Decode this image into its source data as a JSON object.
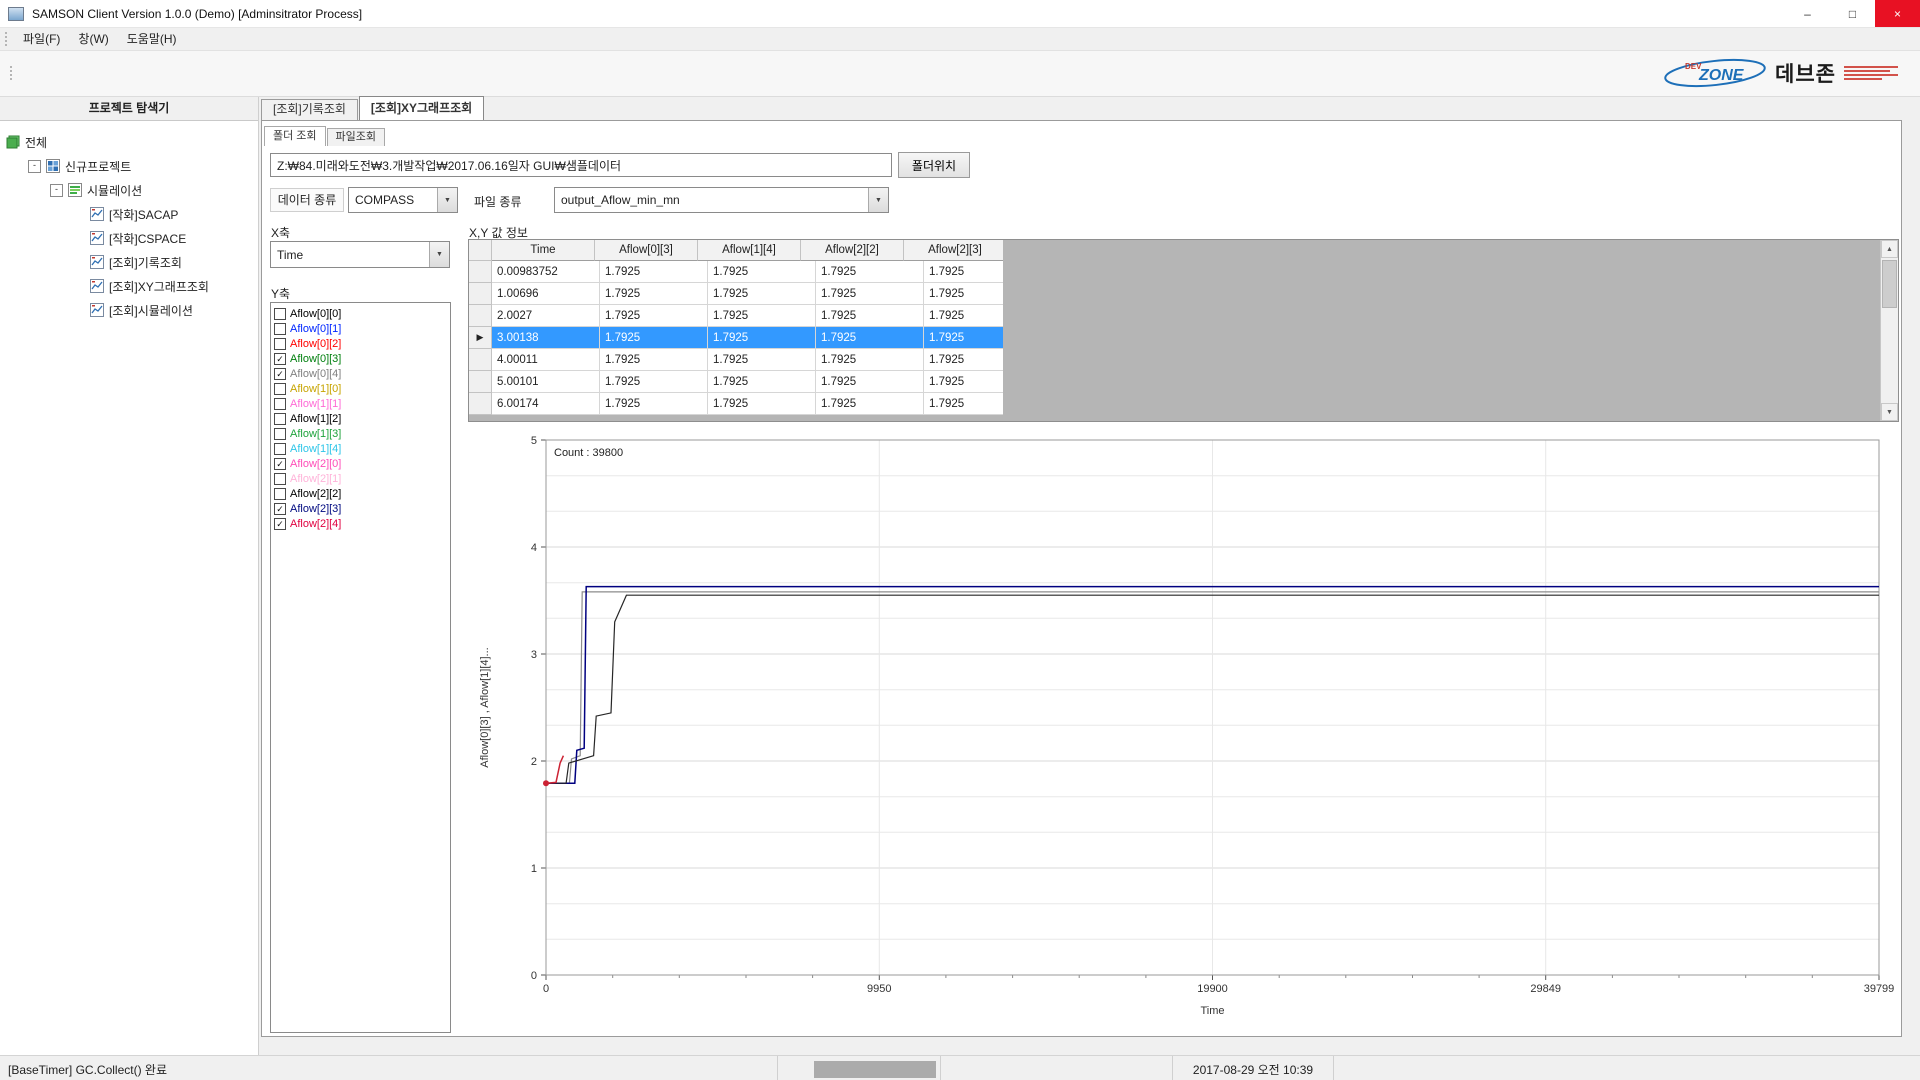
{
  "window": {
    "title": "SAMSON Client Version 1.0.0 (Demo) [Adminsitrator Process]",
    "controls": {
      "minimize": "–",
      "maximize": "□",
      "close": "×"
    }
  },
  "menu": {
    "items": [
      "파일(F)",
      "창(W)",
      "도움말(H)"
    ]
  },
  "logo": {
    "dev": "DEV",
    "zone": "ZONE",
    "name": "데브존"
  },
  "icons": {
    "combo_arrow": "▼",
    "scroll_up": "▲",
    "scroll_down": "▼",
    "expander": "-"
  },
  "explorer": {
    "title": "프로젝트 탐색기",
    "tree": [
      {
        "label": "전체",
        "level": 0,
        "icon": "cube-green",
        "expander": false
      },
      {
        "label": "신규프로젝트",
        "level": 1,
        "icon": "grid-blue",
        "expander": true
      },
      {
        "label": "시뮬레이션",
        "level": 2,
        "icon": "bars-green",
        "expander": true
      },
      {
        "label": "[작화]SACAP",
        "level": 3,
        "icon": "chart-blue",
        "expander": false
      },
      {
        "label": "[작화]CSPACE",
        "level": 3,
        "icon": "chart-blue",
        "expander": false
      },
      {
        "label": "[조회]기록조회",
        "level": 3,
        "icon": "chart-blue",
        "expander": false
      },
      {
        "label": "[조회]XY그래프조회",
        "level": 3,
        "icon": "chart-blue",
        "expander": false
      },
      {
        "label": "[조회]시뮬레이션",
        "level": 3,
        "icon": "chart-blue",
        "expander": false
      }
    ]
  },
  "tabs": [
    {
      "label": "[조회]기록조회",
      "active": false
    },
    {
      "label": "[조회]XY그래프조회",
      "active": true
    }
  ],
  "page": {
    "subtabs": [
      {
        "label": "폴더 조회",
        "active": true
      },
      {
        "label": "파일조회",
        "active": false
      }
    ],
    "path_value": "Z:₩84.미래와도전₩3.개발작업₩2017.06.16일자 GUI₩샘플데이터",
    "folder_button": "폴더위치",
    "data_type_label": "데이터 종류",
    "data_type_value": "COMPASS",
    "file_type_label": "파일 종류",
    "file_type_value": "output_Aflow_min_mn",
    "x_axis_label": "X축",
    "x_axis_value": "Time",
    "y_axis_label": "Y축",
    "table_title": "X,Y 값 정보"
  },
  "y_series": [
    {
      "label": "Aflow[0][0]",
      "color": "#000000",
      "checked": false
    },
    {
      "label": "Aflow[0][1]",
      "color": "#0026ff",
      "checked": false
    },
    {
      "label": "Aflow[0][2]",
      "color": "#ff0000",
      "checked": false
    },
    {
      "label": "Aflow[0][3]",
      "color": "#007f0e",
      "checked": true
    },
    {
      "label": "Aflow[0][4]",
      "color": "#808080",
      "checked": true
    },
    {
      "label": "Aflow[1][0]",
      "color": "#c7a400",
      "checked": false
    },
    {
      "label": "Aflow[1][1]",
      "color": "#ff6ad5",
      "checked": false
    },
    {
      "label": "Aflow[1][2]",
      "color": "#000000",
      "checked": false
    },
    {
      "label": "Aflow[1][3]",
      "color": "#1fa33c",
      "checked": false
    },
    {
      "label": "Aflow[1][4]",
      "color": "#2ec5e8",
      "checked": false
    },
    {
      "label": "Aflow[2][0]",
      "color": "#ff4db8",
      "checked": true
    },
    {
      "label": "Aflow[2][1]",
      "color": "#ffb3d9",
      "checked": false
    },
    {
      "label": "Aflow[2][2]",
      "color": "#000000",
      "checked": false
    },
    {
      "label": "Aflow[2][3]",
      "color": "#000a80",
      "checked": true
    },
    {
      "label": "Aflow[2][4]",
      "color": "#e00040",
      "checked": true
    }
  ],
  "table": {
    "columns": [
      "Time",
      "Aflow[0][3]",
      "Aflow[1][4]",
      "Aflow[2][2]",
      "Aflow[2][3]"
    ],
    "rows": [
      [
        "0.00983752",
        "1.7925",
        "1.7925",
        "1.7925",
        "1.7925"
      ],
      [
        "1.00696",
        "1.7925",
        "1.7925",
        "1.7925",
        "1.7925"
      ],
      [
        "2.0027",
        "1.7925",
        "1.7925",
        "1.7925",
        "1.7925"
      ],
      [
        "3.00138",
        "1.7925",
        "1.7925",
        "1.7925",
        "1.7925"
      ],
      [
        "4.00011",
        "1.7925",
        "1.7925",
        "1.7925",
        "1.7925"
      ],
      [
        "5.00101",
        "1.7925",
        "1.7925",
        "1.7925",
        "1.7925"
      ],
      [
        "6.00174",
        "1.7925",
        "1.7925",
        "1.7925",
        "1.7925"
      ]
    ],
    "selected_index": 3,
    "selected_marker": "▶"
  },
  "chart_data": {
    "type": "line",
    "count_label": "Count : 39800",
    "xlabel": "Time",
    "ylabel": "Aflow[0][3] , Aflow[1][4]...",
    "xlim": [
      0,
      39799
    ],
    "ylim": [
      0,
      5
    ],
    "x_ticks": [
      0,
      9950,
      19900,
      29849,
      39799
    ],
    "y_ticks": [
      0,
      1,
      2,
      3,
      4,
      5
    ],
    "y_minor_per_major": 3,
    "grid": true,
    "legend": "none",
    "series": [
      {
        "name": "Aflow[0][4]",
        "color": "#8c8c8c",
        "width": 1.2,
        "points": [
          [
            0,
            1.7925
          ],
          [
            700,
            1.7925
          ],
          [
            760,
            2.02
          ],
          [
            1020,
            2.05
          ],
          [
            1080,
            3.58
          ],
          [
            39799,
            3.58
          ]
        ]
      },
      {
        "name": "Aflow[2][3]",
        "color": "#000080",
        "width": 1.5,
        "points": [
          [
            0,
            1.7925
          ],
          [
            860,
            1.7925
          ],
          [
            920,
            2.1
          ],
          [
            1140,
            2.12
          ],
          [
            1200,
            3.63
          ],
          [
            39799,
            3.63
          ]
        ]
      },
      {
        "name": "Aflow[2][2]",
        "color": "#262626",
        "width": 1.2,
        "points": [
          [
            0,
            1.7925
          ],
          [
            600,
            1.7925
          ],
          [
            680,
            1.98
          ],
          [
            1420,
            2.05
          ],
          [
            1500,
            2.42
          ],
          [
            1940,
            2.45
          ],
          [
            2050,
            3.3
          ],
          [
            2400,
            3.55
          ],
          [
            39799,
            3.55
          ]
        ]
      },
      {
        "name": "Aflow[2][4]",
        "color": "#cc2233",
        "width": 1.5,
        "marker_start": true,
        "points": [
          [
            0,
            1.7925
          ],
          [
            300,
            1.8
          ],
          [
            420,
            1.98
          ],
          [
            520,
            2.05
          ]
        ]
      }
    ]
  },
  "statusbar": {
    "message": "[BaseTimer] GC.Collect() 완료",
    "datetime": "2017-08-29 오전 10:39"
  }
}
